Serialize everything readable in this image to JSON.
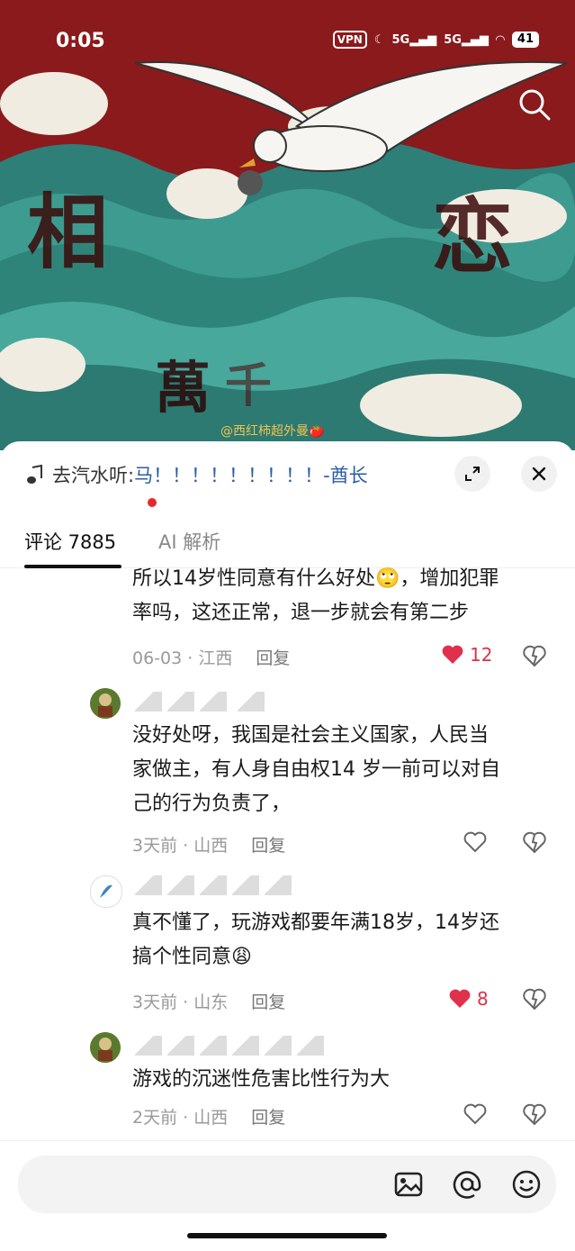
{
  "status": {
    "time": "0:05",
    "vpn": "VPN",
    "net1": "5G",
    "net2": "5G",
    "battery": "41"
  },
  "hero": {
    "watermark": "@西红柿超外曼🍅",
    "art_char_1": "相",
    "art_char_2": "恋",
    "art_char_3": "萬",
    "art_char_4": "千"
  },
  "music": {
    "prefix": "去汽水听: ",
    "title": "马！！！！！！！！！-酋长"
  },
  "tabs": {
    "comments": "评论 7885",
    "ai": "AI 解析"
  },
  "comments": [
    {
      "text_line1": "所以14岁性同意有什么好处🙄，增加犯罪",
      "text_line2": "率吗，这还正常，退一步就会有第二步",
      "date": "06-03",
      "location": "江西",
      "reply": "回复",
      "likes": "12",
      "liked": true
    },
    {
      "text_line1": "没好处呀，我国是社会主义国家，人民当",
      "text_line2": "家做主，有人身自由权14 岁一前可以对自",
      "text_line3": "己的行为负责了，",
      "date": "3天前",
      "location": "山西",
      "reply": "回复",
      "likes": "",
      "liked": false
    },
    {
      "text_line1": "真不懂了，玩游戏都要年满18岁，14岁还",
      "text_line2": "搞个性同意😩",
      "date": "3天前",
      "location": "山东",
      "reply": "回复",
      "likes": "8",
      "liked": true
    },
    {
      "text_line1": "游戏的沉迷性危害比性行为大",
      "date": "2天前",
      "location": "山西",
      "reply": "回复",
      "likes": "",
      "liked": false
    }
  ],
  "colors": {
    "like_red": "#e0304b",
    "link_blue": "#2b5ea8",
    "hero_red": "#8a1a1c",
    "wave_teal": "#3a9a8f"
  }
}
